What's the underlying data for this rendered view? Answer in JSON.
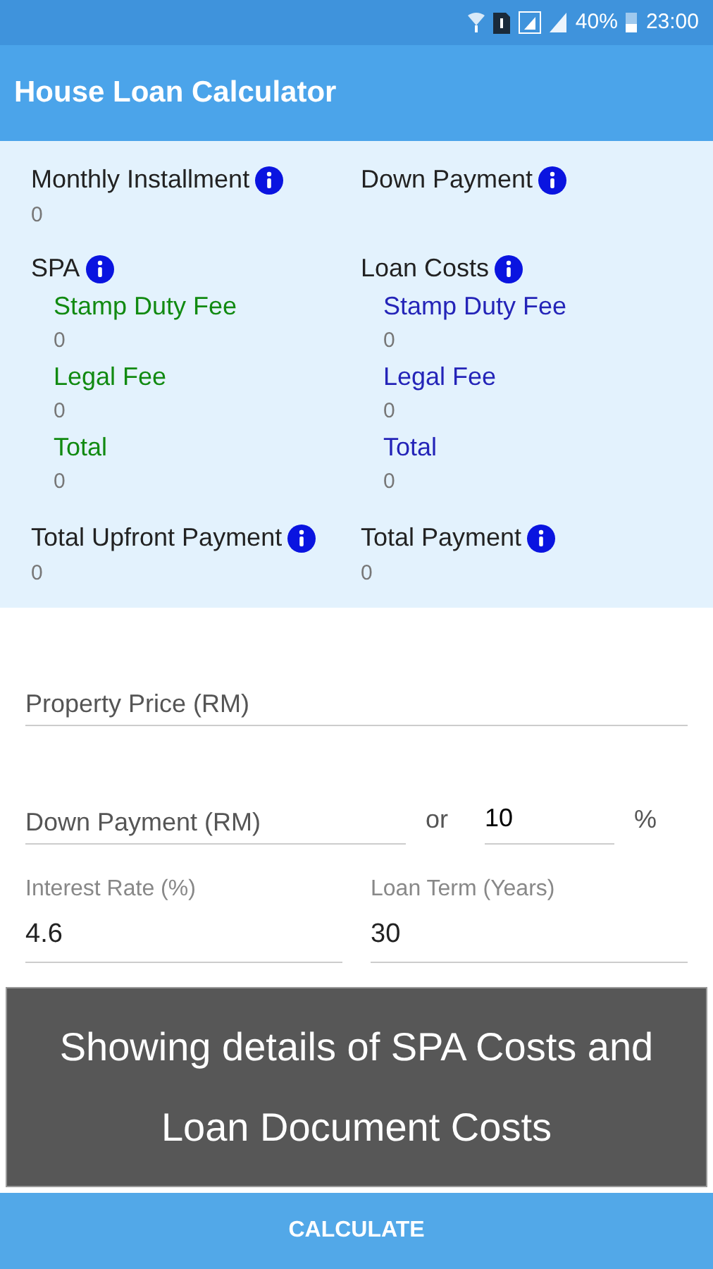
{
  "status_bar": {
    "battery": "40%",
    "time": "23:00"
  },
  "app_bar": {
    "title": "House Loan Calculator"
  },
  "summary": {
    "rows": [
      {
        "kind": "pair",
        "cells": [
          {
            "label": "Monthly Installment",
            "value": "0"
          },
          {
            "label": "Down Payment"
          }
        ]
      },
      {
        "kind": "breakdown",
        "cells": [
          {
            "label": "SPA",
            "color": "#118a11",
            "items": [
              {
                "label": "Stamp Duty Fee",
                "value": "0"
              },
              {
                "label": "Legal Fee",
                "value": "0"
              },
              {
                "label": "Total",
                "value": "0"
              }
            ]
          },
          {
            "label": "Loan Costs",
            "color": "#2424b8",
            "items": [
              {
                "label": "Stamp Duty Fee",
                "value": "0"
              },
              {
                "label": "Legal Fee",
                "value": "0"
              },
              {
                "label": "Total",
                "value": "0"
              }
            ]
          }
        ]
      },
      {
        "kind": "pair",
        "cells": [
          {
            "label": "Total Upfront Payment",
            "value": "0"
          },
          {
            "label": "Total Payment",
            "value": "0"
          }
        ]
      }
    ]
  },
  "form": {
    "property_price": {
      "placeholder": "Property Price (RM)"
    },
    "down_payment": {
      "placeholder": "Down Payment (RM)"
    },
    "or_label": "or",
    "percent": {
      "value": "10"
    },
    "percent_sign": "%",
    "interest_rate": {
      "label": "Interest Rate (%)",
      "value": "4.6"
    },
    "loan_term": {
      "label": "Loan Term (Years)",
      "value": "30"
    }
  },
  "banner": {
    "text": "Showing details of SPA Costs and Loan Document Costs"
  },
  "calculate_button": {
    "label": "CALCULATE"
  }
}
